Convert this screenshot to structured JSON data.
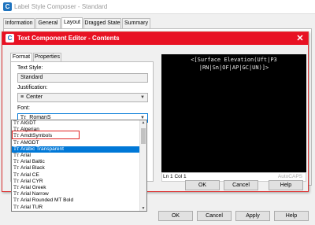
{
  "outer": {
    "app_icon": "C",
    "title": "Label Style Composer - Standard",
    "tabs": [
      "Information",
      "General",
      "Layout",
      "Dragged State",
      "Summary"
    ],
    "buttons": [
      "OK",
      "Cancel",
      "Apply",
      "Help"
    ]
  },
  "dialog": {
    "icon": "C",
    "title": "Text Component Editor - Contents",
    "close": "✕",
    "tabs": [
      "Format",
      "Properties"
    ],
    "text_style_label": "Text Style:",
    "text_style_value": "Standard",
    "justification_label": "Justification:",
    "justification_value": "Center",
    "justification_icon": "≡",
    "font_label": "Font:",
    "font_value": "RomanS",
    "editor_lines": [
      "<[Surface Elevation(Uft|P3",
      "|RN|Sn|OF|AP|GC|UN)]>"
    ],
    "status_text": "Ln 1 Col 1",
    "status_right": "AutoCAPS",
    "buttons": [
      "OK",
      "Cancel",
      "Help"
    ]
  },
  "font_list": {
    "items": [
      "AIGDT",
      "Algerian",
      "AmdtSymbols",
      "AMGDT",
      "Arabic Transparent",
      "Arial",
      "Arial Baltic",
      "Arial Black",
      "Arial CE",
      "Arial CYR",
      "Arial Greek",
      "Arial Narrow",
      "Arial Rounded MT Bold",
      "Arial TUR"
    ],
    "selected_index": 4,
    "highlighted_index": 5,
    "truetype_glyph": "Tт"
  },
  "colors": {
    "dialog_title_bg": "#e81123",
    "selection": "#0078d7",
    "highlight_box": "#e02020",
    "editor_bg": "#000000"
  }
}
